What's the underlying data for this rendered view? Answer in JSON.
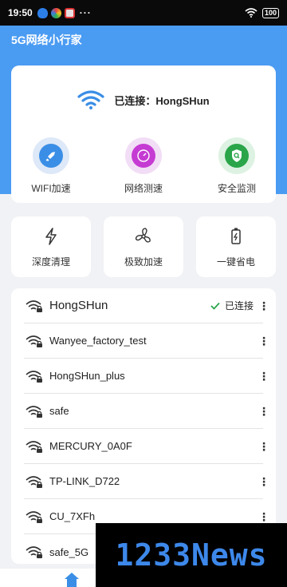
{
  "status_bar": {
    "time": "19:50",
    "dots": "···",
    "battery": "100"
  },
  "app": {
    "title": "5G网络小行家"
  },
  "connection": {
    "status_label": "已连接：HongSHun"
  },
  "features": [
    {
      "label": "WIFI加速",
      "icon": "rocket-icon",
      "color": "#3a8ee6"
    },
    {
      "label": "网络测速",
      "icon": "speedometer-icon",
      "color": "#c53ad2"
    },
    {
      "label": "安全监测",
      "icon": "shield-search-icon",
      "color": "#2aa54a"
    }
  ],
  "tools": [
    {
      "label": "深度清理",
      "icon": "lightning-icon"
    },
    {
      "label": "极致加速",
      "icon": "fan-icon"
    },
    {
      "label": "一键省电",
      "icon": "battery-charge-icon"
    }
  ],
  "wifi_list": {
    "connected_label": "已连接",
    "networks": [
      {
        "name": "HongSHun"
      },
      {
        "name": "Wanyee_factory_test"
      },
      {
        "name": "HongSHun_plus"
      },
      {
        "name": "safe"
      },
      {
        "name": "MERCURY_0A0F"
      },
      {
        "name": "TP-LINK_D722"
      },
      {
        "name": "CU_7XFh"
      },
      {
        "name": "safe_5G"
      }
    ]
  },
  "watermark": {
    "text": "1233News"
  }
}
